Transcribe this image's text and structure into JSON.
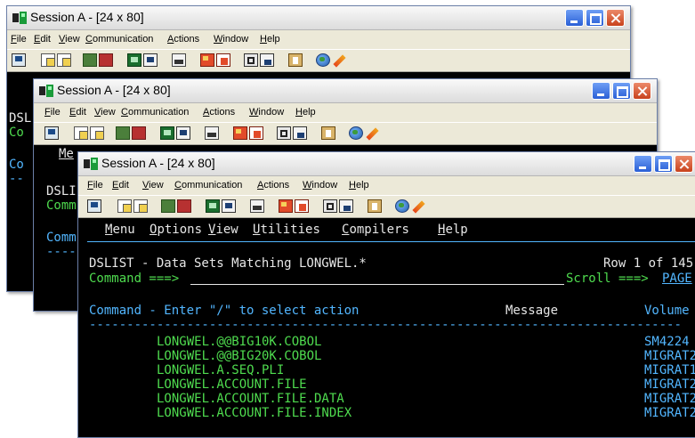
{
  "window": {
    "title": "Session A - [24 x 80]",
    "menu": [
      "File",
      "Edit",
      "View",
      "Communication",
      "Actions",
      "Window",
      "Help"
    ]
  },
  "toolbar_icons": [
    "monitor-icon",
    "copy-icon",
    "paste-icon",
    "send-icon",
    "receive-icon",
    "screen-icon",
    "screen-alt-icon",
    "print-icon",
    "macro-record-icon",
    "macro-play-icon",
    "disk-icon",
    "disk-alt-icon",
    "clipboard-icon",
    "globe-icon",
    "pen-icon"
  ],
  "back_window_1": {
    "screen_fragments": [
      "DSL",
      "Co",
      "Co",
      "--"
    ]
  },
  "back_window_2": {
    "screen_fragments": [
      "Me",
      "DSLI",
      "Comm",
      "Comm",
      "----"
    ]
  },
  "terminal": {
    "menu": [
      "Menu",
      "Options",
      "View",
      "Utilities",
      "Compilers",
      "Help"
    ],
    "title_line": "DSLIST - Data Sets Matching LONGWEL.*",
    "row_info": "Row 1 of 145",
    "command_label": "Command ===>",
    "scroll_label": "Scroll ===>",
    "scroll_value": "PAGE",
    "header_command": "Command - Enter \"/\" to select action",
    "header_message": "Message",
    "header_volume": "Volume",
    "divider": "-------------------------------------------------------------------------------",
    "datasets": [
      {
        "name": "LONGWEL.@@BIG10K.COBOL",
        "volume": "SM4224"
      },
      {
        "name": "LONGWEL.@@BIG20K.COBOL",
        "volume": "MIGRAT2"
      },
      {
        "name": "LONGWEL.A.SEQ.PLI",
        "volume": "MIGRAT1"
      },
      {
        "name": "LONGWEL.ACCOUNT.FILE",
        "volume": "MIGRAT2"
      },
      {
        "name": "LONGWEL.ACCOUNT.FILE.DATA",
        "volume": "MIGRAT2"
      },
      {
        "name": "LONGWEL.ACCOUNT.FILE.INDEX",
        "volume": "MIGRAT2"
      }
    ]
  },
  "colors": {
    "terminal_bg": "#000000",
    "terminal_text": "#e7e7e7",
    "terminal_cyan": "#52b6ff",
    "terminal_green": "#4fdc4f"
  }
}
